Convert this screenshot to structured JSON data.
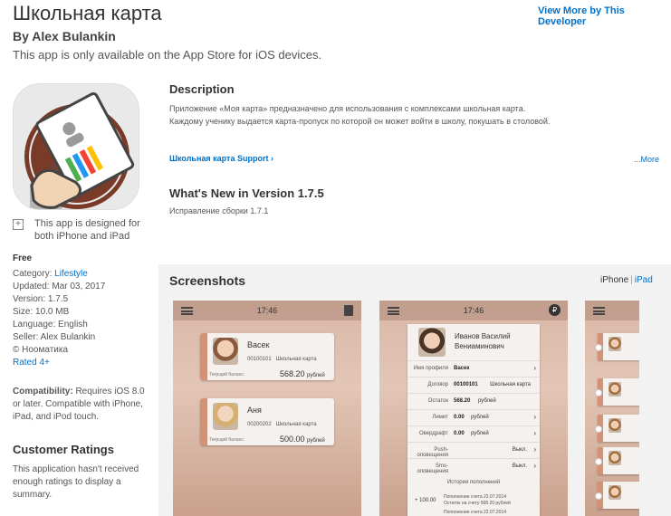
{
  "header": {
    "title": "Школьная карта",
    "author": "By Alex Bulankin",
    "availability": "This app is only available on the App Store for iOS devices.",
    "view_more": "View More by This Developer"
  },
  "sidebar": {
    "designed_for": "This app is designed for both iPhone and iPad",
    "price": "Free",
    "category_label": "Category: ",
    "category_value": "Lifestyle",
    "updated": "Updated: Mar 03, 2017",
    "version": "Version: 1.7.5",
    "size": "Size: 10.0 MB",
    "language": "Language: English",
    "seller": "Seller: Alex Bulankin",
    "copyright": "© Нооматика",
    "rated": "Rated 4+",
    "compatibility_label": "Compatibility:",
    "compatibility_text": " Requires iOS 8.0 or later. Compatible with iPhone, iPad, and iPod touch.",
    "customer_ratings_title": "Customer Ratings",
    "customer_ratings_text": "This application hasn't received enough ratings to display a summary."
  },
  "description": {
    "title": "Description",
    "line1": "Приложение «Моя карта» предназначено для использования с комплексами школьная карта.",
    "line2": "Каждому ученику выдается карта-пропуск по которой он может войти в школу, покушать в столовой.",
    "support_link": "Школьная карта Support",
    "more_prefix": "...",
    "more_link": "More"
  },
  "whats_new": {
    "title": "What's New in Version 1.7.5",
    "text": "Исправление сборки 1.7.1"
  },
  "screenshots": {
    "title": "Screenshots",
    "device_iphone": "iPhone",
    "device_sep": "|",
    "device_ipad": "iPad",
    "time": "17:46",
    "cards": [
      {
        "name": "Васек",
        "number": "00100101",
        "card_type": "Школьная карта",
        "balance_label": "Текущий баланс:",
        "balance": "568.20",
        "currency": "рублей"
      },
      {
        "name": "Аня",
        "number": "00200202",
        "card_type": "Школьная карта",
        "balance_label": "Текущий баланс:",
        "balance": "500.00",
        "currency": "рублей"
      }
    ],
    "detail": {
      "name": "Иванов Василий Вениаминович",
      "rows": [
        {
          "label": "Имя профиля",
          "value": "Васек",
          "value2": ""
        },
        {
          "label": "Договор",
          "value": "00100101",
          "value2": "Школьная карта"
        },
        {
          "label": "Остаток",
          "value": "568.20",
          "value2": "рублей"
        },
        {
          "label": "Лимит",
          "value": "0.00",
          "value2": "рублей"
        },
        {
          "label": "Овердрафт",
          "value": "0.00",
          "value2": "рублей"
        },
        {
          "label": "Push-оповещения",
          "value": "",
          "value2": "Выкл."
        },
        {
          "label": "Sms-оповещения",
          "value": "",
          "value2": "Выкл."
        }
      ],
      "history_title": "История пополнений",
      "history_amount": "+ 100.00",
      "history_line1": "Пополнение счета 22.07.2014",
      "history_line2": "Остаток на счету 568.20 рублей",
      "history_line3": "Пополнение счета 22.07.2014"
    }
  }
}
